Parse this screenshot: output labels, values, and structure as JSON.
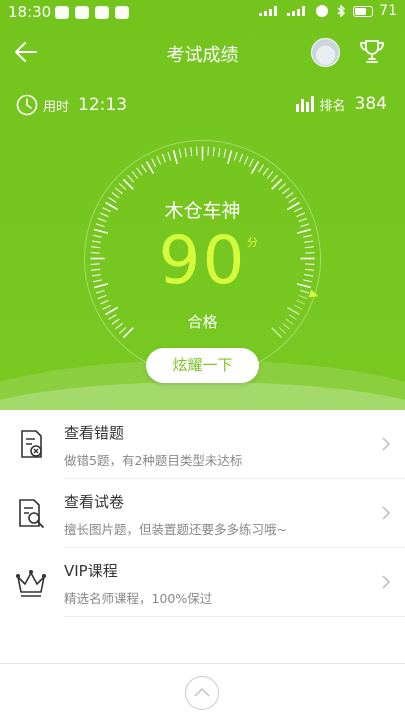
{
  "status_bar": {
    "time": "18:30",
    "battery": "71"
  },
  "header": {
    "title": "考试成绩"
  },
  "stats": {
    "time_label": "用时",
    "time_value": "12:13",
    "rank_label": "排名",
    "rank_value": "384"
  },
  "result": {
    "name": "木仓车神",
    "score": "90",
    "score_unit": "分",
    "status": "合格",
    "share_label": "炫耀一下",
    "gauge_fraction": 0.9
  },
  "menu": [
    {
      "title": "查看错题",
      "subtitle": "做错5题，有2种题目类型未达标",
      "icon": "wrong-questions-icon"
    },
    {
      "title": "查看试卷",
      "subtitle": "擅长图片题，但装置题还要多多练习哦~",
      "icon": "review-paper-icon"
    },
    {
      "title": "VIP课程",
      "subtitle": "精选名师课程，100%保过",
      "icon": "crown-icon"
    }
  ],
  "colors": {
    "primary": "#78c821",
    "score": "#d6fa3c",
    "text": "#333333",
    "subtext": "#888888"
  }
}
